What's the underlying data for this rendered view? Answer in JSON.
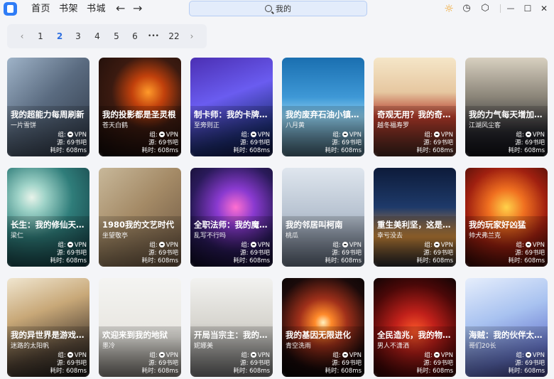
{
  "nav": {
    "items": [
      "首页",
      "书架",
      "书城"
    ],
    "back": "←",
    "forward": "→"
  },
  "search": {
    "value": "我的"
  },
  "tools": {
    "sun": "☼",
    "history": "◷",
    "settings": "⬡",
    "minimize": "—",
    "maximize": "☐",
    "close": "✕"
  },
  "pagination": {
    "prev": "‹",
    "pages": [
      "1",
      "2",
      "3",
      "4",
      "5",
      "6"
    ],
    "active": "2",
    "ellipsis": "•••",
    "last": "22",
    "next": "›"
  },
  "labels": {
    "group": "组:",
    "group_value": "VPN",
    "source": "源:",
    "source_value": "69书吧",
    "time": "耗时:",
    "time_value": "608ms"
  },
  "books": [
    {
      "title": "我的超能力每周刷新",
      "author": "一片雪饼",
      "bg": "linear-gradient(135deg,#9fb3c8 0%,#5a6b80 45%,#2b3442 100%)"
    },
    {
      "title": "我的投影都是圣灵根",
      "author": "苍天白鹤",
      "bg": "radial-gradient(circle at 60% 35%,#ff9a2a 0%,#c2410c 20%,#3b1a10 45%,#120a08 100%)"
    },
    {
      "title": "制卡师：我的卡牌无限强化",
      "author": "至旁则正",
      "bg": "linear-gradient(160deg,#4b2fb3 0%,#6a5cf0 40%,#20307a 75%,#0d1238 100%)"
    },
    {
      "title": "我的废弃石油小镇成了新一线",
      "author": "八月黄",
      "bg": "linear-gradient(180deg,#1a6fb0 0%,#3e98d6 40%,#8fd0f0 60%,#4a6a7a 100%)",
      "cover": "废弃石油小镇"
    },
    {
      "title": "奇观无用？我的奇观能变现",
      "author": "越冬福寿罗",
      "bg": "linear-gradient(180deg,#f5e6c8 0%,#e6c7a0 35%,#b43a2a 60%,#4a2a22 100%)"
    },
    {
      "title": "我的力气每天增加一点点",
      "author": "江湖风尘客",
      "bg": "linear-gradient(180deg,#d8d0c0 0%,#8a8478 40%,#2a2a30 75%,#121218 100%)",
      "cover": "我的力"
    },
    {
      "title": "长生：我的修仙天赋能加点",
      "author": "梁仁",
      "bg": "radial-gradient(circle at 30% 30%,#e8f3ea 0%,#9fd3c8 15%,#2f7d7a 45%,#0f2e36 100%)"
    },
    {
      "title": "1980我的文艺时代",
      "author": "坐望敬亭",
      "bg": "linear-gradient(135deg,#c8b89a 0%,#a48a66 45%,#6a5440 100%)",
      "cover": "我的文艺"
    },
    {
      "title": "全职法师：我的魔法无限进化",
      "author": "乱写不行吗",
      "bg": "radial-gradient(circle at 55% 40%,#ff6fd0 0%,#8a3ad0 25%,#2a1a5a 60%,#0c0a20 100%)"
    },
    {
      "title": "我的邻居叫柯南",
      "author": "桃瓜",
      "bg": "linear-gradient(180deg,#dfe6ee 0%,#b9c4d2 45%,#6b7688 100%)"
    },
    {
      "title": "重生美利坚，这是我的时代",
      "author": "幸亏没去",
      "bg": "linear-gradient(180deg,#0d1b3a 0%,#1e3a6a 40%,#c9873a 70%,#2a2a30 100%)"
    },
    {
      "title": "我的玩家好凶猛",
      "author": "帅犬弗兰克",
      "bg": "radial-gradient(circle at 50% 40%,#ffd24a 0%,#f07020 25%,#a02010 55%,#2a0806 100%)"
    },
    {
      "title": "我的异世界是游戏世界",
      "author": "迷路的太阳帆",
      "bg": "linear-gradient(160deg,#f0e6d0 0%,#c8a878 35%,#5a4a3a 70%,#1a1a1a 100%)"
    },
    {
      "title": "欢迎来到我的地狱",
      "author": "墨冷",
      "bg": "linear-gradient(180deg,#f4f4f2 0%,#e8e6e0 60%,#8a8680 100%)",
      "cover": "地狱"
    },
    {
      "title": "开局当宗主：我的弟子全是神",
      "author": "妮娜美",
      "bg": "linear-gradient(180deg,#f2f2f0 0%,#d8d6d0 45%,#7a7a7a 100%)",
      "cover": "我的有"
    },
    {
      "title": "我的基因无限进化",
      "author": "青空洗雨",
      "bg": "radial-gradient(circle at 50% 45%,#fff2c0 0%,#ff8a2a 12%,#a0301a 35%,#1a0a0a 70%,#050505 100%)"
    },
    {
      "title": "全民造兆，我的物品无限升级",
      "author": "男人不潇洒",
      "bg": "radial-gradient(circle at 50% 55%,#ff5a2a 0%,#c0201a 30%,#4a0808 70%,#120404 100%)"
    },
    {
      "title": "海贼：我的伙伴太凶猛",
      "author": "哥们20长",
      "bg": "linear-gradient(160deg,#e6eefc 0%,#a8c2f0 40%,#6a7ad0 75%,#3a3a7a 100%)",
      "cover": "海贼"
    }
  ]
}
